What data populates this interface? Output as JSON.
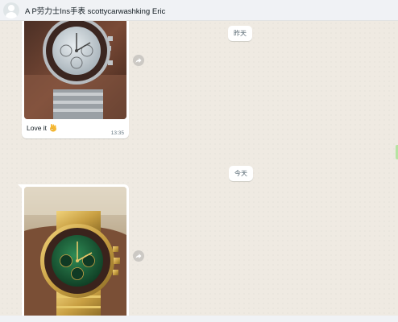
{
  "header": {
    "title": "A P劳力士Ins手表 scottycarwashking Eric"
  },
  "messages": [
    {
      "date_label": "昨天",
      "caption": "Love it",
      "time": "13:35",
      "photo": "watch-photo-brown-bezel-silver-dial"
    },
    {
      "date_label": "今天",
      "photo": "watch-photo-gold-green-dial"
    }
  ],
  "icons": {
    "avatar": "default-avatar-icon",
    "forward": "forward-icon",
    "emoji": "ok-hand-emoji"
  },
  "colors": {
    "chat_background": "#efeae2",
    "bubble": "#ffffff",
    "header": "#f0f2f5"
  }
}
